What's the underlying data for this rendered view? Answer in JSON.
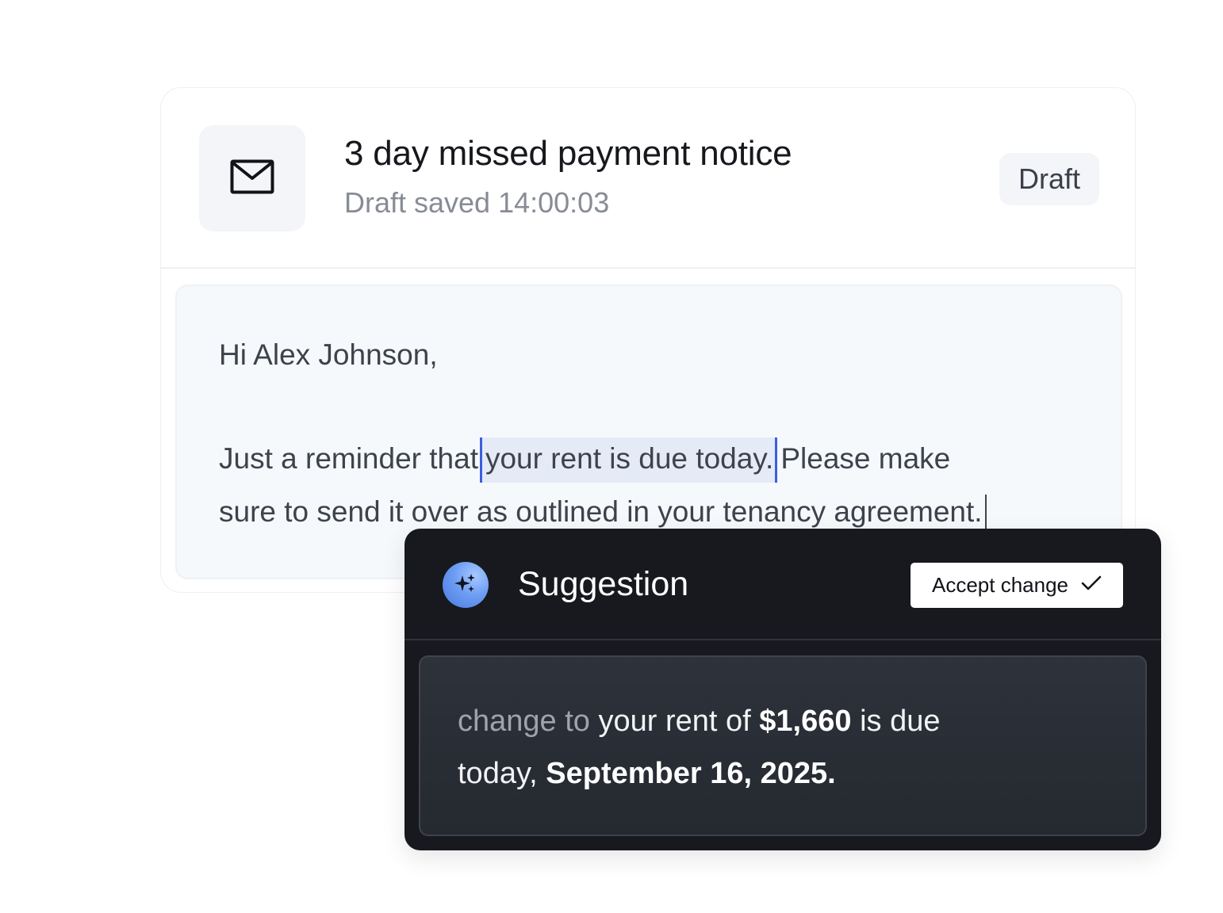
{
  "email": {
    "title": "3 day missed payment notice",
    "saved_status": "Draft saved 14:00:03",
    "badge": "Draft",
    "icon": "envelope-icon",
    "greeting": "Hi Alex Johnson,",
    "line1_before": "Just a reminder that",
    "line1_highlight": "your rent is due today.",
    "line1_after": "Please make",
    "line2": "sure to send it over as outlined in your tenancy agreement."
  },
  "suggestion": {
    "title": "Suggestion",
    "icon": "sparkle-icon",
    "accept_label": "Accept change",
    "accept_icon": "check-icon",
    "prefix": "change to",
    "part1": "your rent of",
    "amount": "$1,660",
    "part2": "is due",
    "part3": "today,",
    "date": "September 16, 2025."
  },
  "colors": {
    "accent": "#3b5de0",
    "panel_bg": "#17191e",
    "highlight_bg": "#e5eaf7"
  }
}
